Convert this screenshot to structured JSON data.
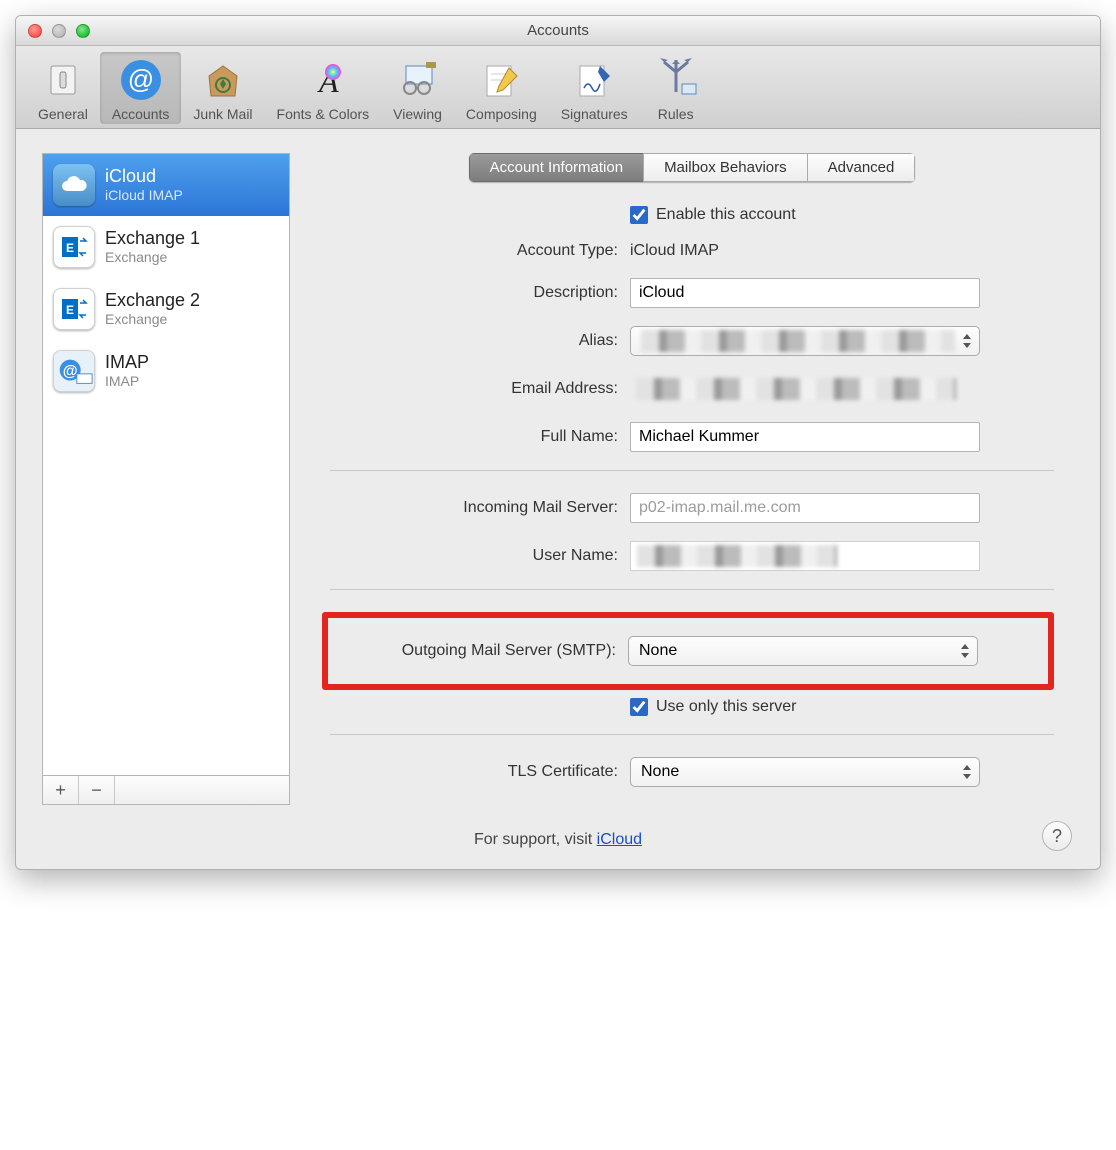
{
  "window": {
    "title": "Accounts"
  },
  "toolbar": {
    "items": [
      {
        "label": "General"
      },
      {
        "label": "Accounts"
      },
      {
        "label": "Junk Mail"
      },
      {
        "label": "Fonts & Colors"
      },
      {
        "label": "Viewing"
      },
      {
        "label": "Composing"
      },
      {
        "label": "Signatures"
      },
      {
        "label": "Rules"
      }
    ],
    "selected": "Accounts"
  },
  "sidebar": {
    "accounts": [
      {
        "title": "iCloud",
        "subtitle": "iCloud IMAP",
        "icon": "icloud",
        "selected": true
      },
      {
        "title": "Exchange 1",
        "subtitle": "Exchange",
        "icon": "exchange"
      },
      {
        "title": "Exchange 2",
        "subtitle": "Exchange",
        "icon": "exchange"
      },
      {
        "title": "IMAP",
        "subtitle": "IMAP",
        "icon": "imap"
      }
    ],
    "add_label": "+",
    "remove_label": "−"
  },
  "tabs": {
    "items": [
      "Account Information",
      "Mailbox Behaviors",
      "Advanced"
    ],
    "selected": "Account Information"
  },
  "form": {
    "enable_label": "Enable this account",
    "enable_checked": true,
    "account_type_label": "Account Type:",
    "account_type_value": "iCloud IMAP",
    "description_label": "Description:",
    "description_value": "iCloud",
    "alias_label": "Alias:",
    "alias_value": "",
    "email_label": "Email Address:",
    "email_value": "",
    "fullname_label": "Full Name:",
    "fullname_value": "Michael Kummer",
    "incoming_label": "Incoming Mail Server:",
    "incoming_value": "p02-imap.mail.me.com",
    "username_label": "User Name:",
    "username_value": "",
    "smtp_label": "Outgoing Mail Server (SMTP):",
    "smtp_value": "None",
    "useonly_label": "Use only this server",
    "useonly_checked": true,
    "tls_label": "TLS Certificate:",
    "tls_value": "None"
  },
  "footer": {
    "support_prefix": "For support, visit ",
    "support_link": "iCloud"
  }
}
